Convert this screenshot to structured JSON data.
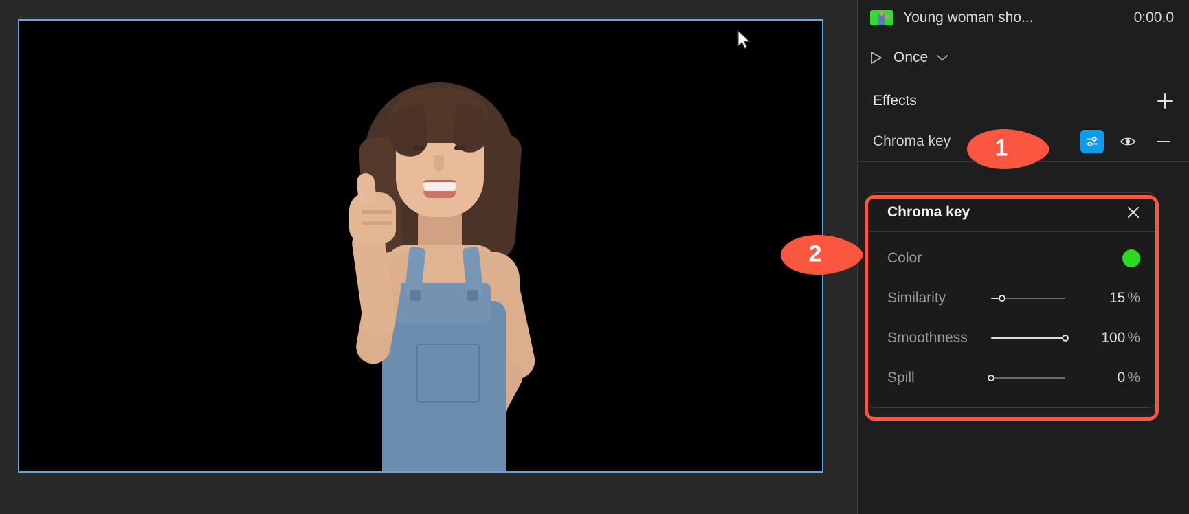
{
  "window": {
    "app_background": "#292929",
    "panel_background": "#1e1e1e"
  },
  "preview": {
    "name": "video-preview",
    "selection_border_color": "#5fa8e8",
    "canvas_color": "#000000",
    "cursor": "arrow-pointer"
  },
  "inspector": {
    "clip": {
      "thumbnail": "clip-thumbnail",
      "title": "Young woman sho...",
      "timecode": "0:00.0"
    },
    "playback": {
      "play_icon": "play-icon",
      "mode_label": "Once",
      "chevron": "chevron-down-icon"
    },
    "effects": {
      "title": "Effects",
      "add_label": "+",
      "items": [
        {
          "name": "Chroma key",
          "settings_icon": "sliders-icon",
          "settings_active": true,
          "visibility_icon": "eye-icon",
          "remove_icon": "minus-icon"
        }
      ]
    }
  },
  "popover": {
    "title": "Chroma key",
    "close_icon": "close-icon",
    "properties": [
      {
        "label": "Color",
        "type": "swatch",
        "color": "#2fd91f",
        "value": "",
        "unit": ""
      },
      {
        "label": "Similarity",
        "type": "slider",
        "value": "15",
        "unit": "%",
        "percent": 15
      },
      {
        "label": "Smoothness",
        "type": "slider",
        "value": "100",
        "unit": "%",
        "percent": 100
      },
      {
        "label": "Spill",
        "type": "slider",
        "value": "0",
        "unit": "%",
        "percent": 0
      }
    ]
  },
  "annotations": {
    "accent_color": "#fb5640",
    "callouts": [
      {
        "label": "1",
        "target": "chroma-key-settings-button"
      },
      {
        "label": "2",
        "target": "chroma-key-popover"
      }
    ]
  }
}
